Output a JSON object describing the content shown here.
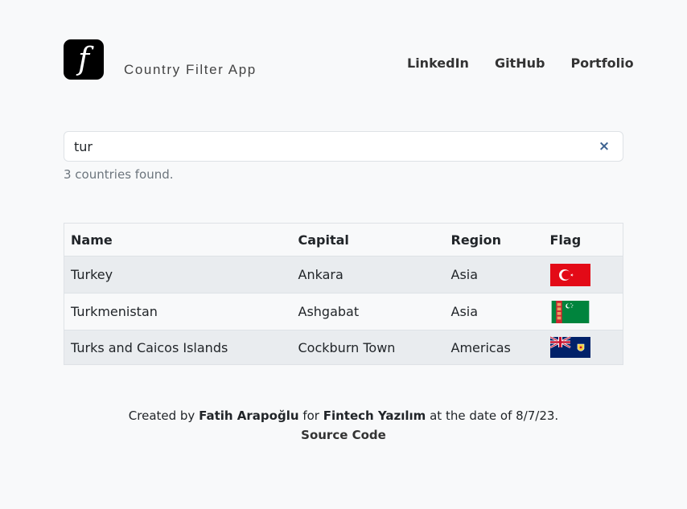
{
  "header": {
    "logo_letter": "f",
    "app_title": "Country Filter App",
    "nav": [
      {
        "label": "LinkedIn"
      },
      {
        "label": "GitHub"
      },
      {
        "label": "Portfolio"
      }
    ]
  },
  "search": {
    "value": "tur",
    "clear_icon": "×"
  },
  "result_text": "3 countries found.",
  "table": {
    "headers": [
      "Name",
      "Capital",
      "Region",
      "Flag"
    ],
    "rows": [
      {
        "name": "Turkey",
        "capital": "Ankara",
        "region": "Asia",
        "flag": "turkey-flag"
      },
      {
        "name": "Turkmenistan",
        "capital": "Ashgabat",
        "region": "Asia",
        "flag": "turkmenistan-flag"
      },
      {
        "name": "Turks and Caicos Islands",
        "capital": "Cockburn Town",
        "region": "Americas",
        "flag": "turks-caicos-flag"
      }
    ]
  },
  "footer": {
    "created_by": "Created by",
    "author": "Fatih Arapoğlu",
    "for": "for",
    "company": "Fintech Yazılım",
    "date_text": "at the date of 8/7/23.",
    "source_code": "Source Code"
  },
  "colors": {
    "turkey_red": "#e30a17",
    "turkmen_green": "#00843d",
    "tc_blue": "#012169"
  }
}
